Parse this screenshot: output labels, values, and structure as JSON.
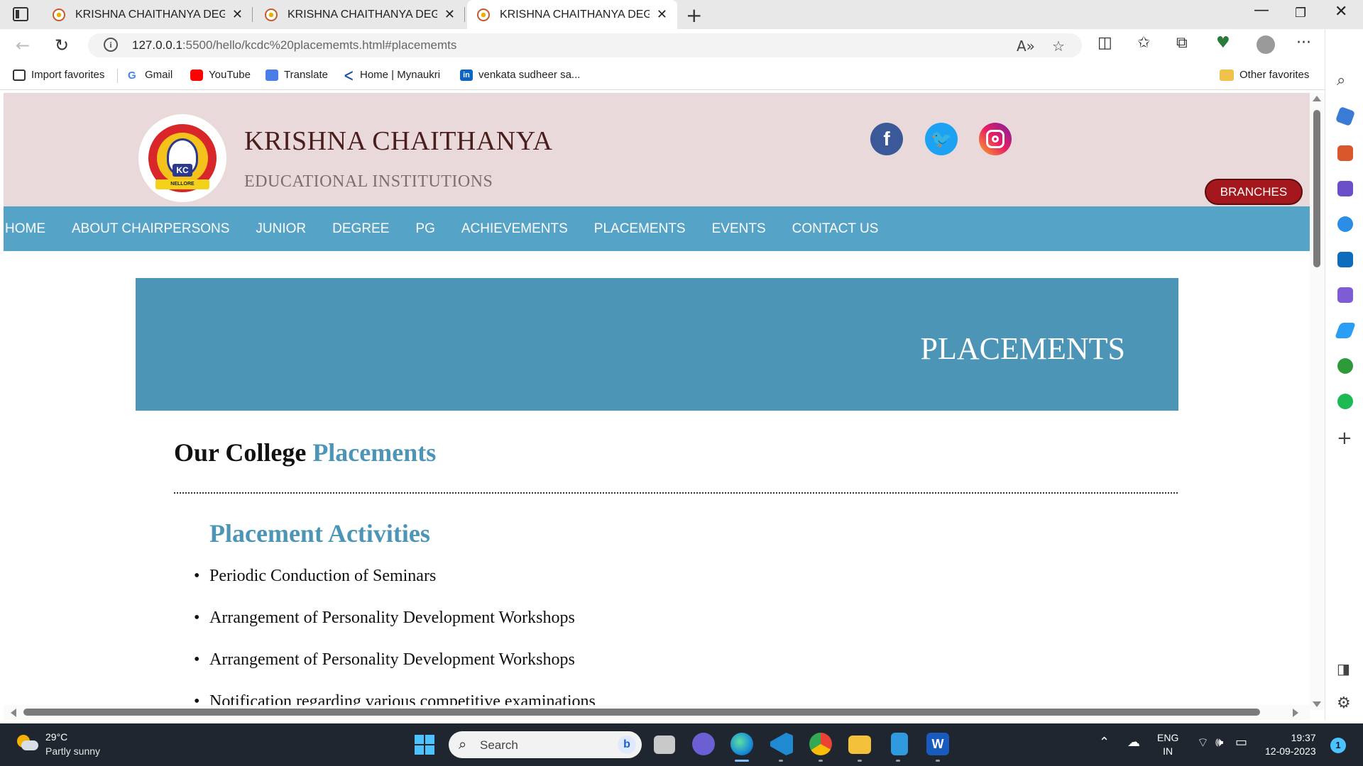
{
  "browser": {
    "tabs": [
      {
        "title": "KRISHNA CHAITHANYA DEGREE",
        "close": "✕",
        "active": false
      },
      {
        "title": "KRISHNA CHAITHANYA DEGREE",
        "close": "✕",
        "active": false
      },
      {
        "title": "KRISHNA CHAITHANYA DEGREE",
        "close": "✕",
        "active": true
      }
    ],
    "new_tab": "+",
    "url_host": "127.0.0.1",
    "url_rest": ":5500/hello/kcdc%20placememts.html#placememts",
    "favorites": [
      {
        "label": "Import favorites",
        "icon": "import-icon"
      },
      {
        "label": "Gmail",
        "icon": "google-icon"
      },
      {
        "label": "YouTube",
        "icon": "youtube-icon"
      },
      {
        "label": "Translate",
        "icon": "translate-icon"
      },
      {
        "label": "Home | Mynaukri",
        "icon": "mynaukri-icon"
      },
      {
        "label": "venkata sudheer sa...",
        "icon": "linkedin-icon"
      }
    ],
    "other_favorites": "Other favorites"
  },
  "site": {
    "brand_title": "KRISHNA CHAITHANYA",
    "brand_subtitle": "EDUCATIONAL INSTITUTIONS",
    "logo_text": "KC",
    "logo_ribbon": "NELLORE",
    "social": {
      "facebook": "f",
      "twitter": "🐦"
    },
    "branches_button": "BRANCHES",
    "nav": [
      "HOME",
      "ABOUT CHAIRPERSONS",
      "JUNIOR",
      "DEGREE",
      "PG",
      "ACHIEVEMENTS",
      "PLACEMENTS",
      "EVENTS",
      "CONTACT US"
    ],
    "banner_title": "PLACEMENTS",
    "heading_plain": "Our College ",
    "heading_accent": "Placements",
    "subheading": "Placement Activities",
    "activities": [
      "Periodic Conduction of Seminars",
      "Arrangement of Personality Development Workshops",
      "Arrangement of Personality Development Workshops",
      "Notification regarding various competitive examinations"
    ],
    "colors": {
      "nav": "#55a4c8",
      "banner": "#4d95b6",
      "header": "#ead9da",
      "branches": "#a4181d"
    }
  },
  "taskbar": {
    "temperature": "29°C",
    "weather": "Partly sunny",
    "search_label": "Search",
    "lang_1": "ENG",
    "lang_2": "IN",
    "time": "19:37",
    "date": "12-09-2023",
    "notifications": "1"
  }
}
